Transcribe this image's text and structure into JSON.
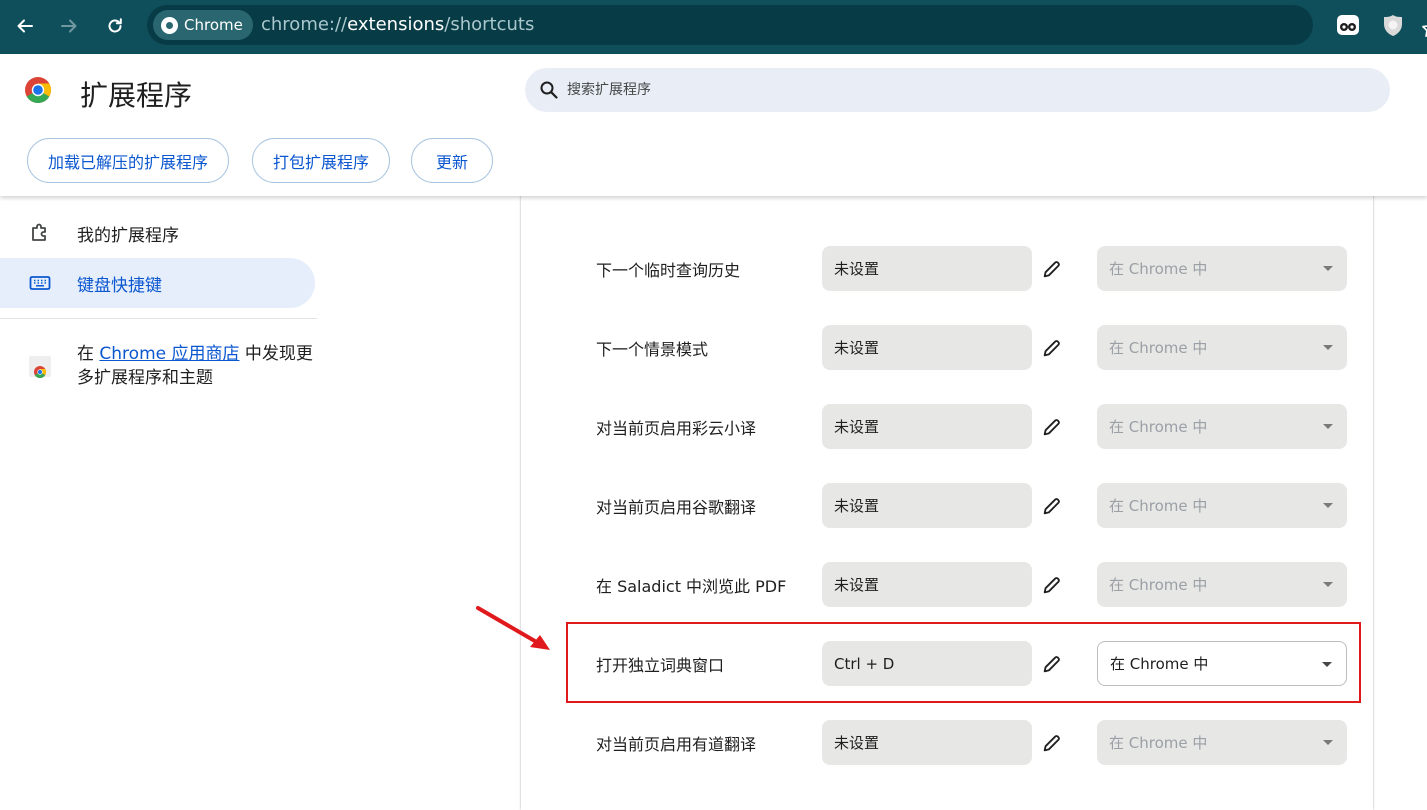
{
  "browser": {
    "chip_label": "Chrome",
    "url_prefix": "chrome://",
    "url_host": "extensions",
    "url_path": "/shortcuts",
    "icons": [
      "back-arrow-icon",
      "forward-arrow-icon",
      "reload-icon",
      "chrome-chip-icon",
      "bookmark-star-icon",
      "extension-face-icon",
      "extension-shield-icon"
    ]
  },
  "header": {
    "title": "扩展程序",
    "search_placeholder": "搜索扩展程序",
    "buttons": {
      "load_unpacked": "加载已解压的扩展程序",
      "pack": "打包扩展程序",
      "update": "更新"
    }
  },
  "sidebar": {
    "items": [
      {
        "label": "我的扩展程序",
        "icon": "puzzle-icon",
        "active": false
      },
      {
        "label": "键盘快捷键",
        "icon": "keyboard-icon",
        "active": true
      }
    ],
    "store": {
      "prefix": "在 ",
      "link": "Chrome 应用商店",
      "suffix": " 中发现更多扩展程序和主题",
      "icon": "webstore-icon"
    }
  },
  "shortcuts": {
    "rows": [
      {
        "command": "下一个临时查询历史",
        "key": "未设置",
        "scope": "在 Chrome 中",
        "enabled": false
      },
      {
        "command": "下一个情景模式",
        "key": "未设置",
        "scope": "在 Chrome 中",
        "enabled": false
      },
      {
        "command": "对当前页启用彩云小译",
        "key": "未设置",
        "scope": "在 Chrome 中",
        "enabled": false
      },
      {
        "command": "对当前页启用谷歌翻译",
        "key": "未设置",
        "scope": "在 Chrome 中",
        "enabled": false
      },
      {
        "command": "在 Saladict 中浏览此 PDF",
        "key": "未设置",
        "scope": "在 Chrome 中",
        "enabled": false
      },
      {
        "command": "打开独立词典窗口",
        "key": "Ctrl + D",
        "scope": "在 Chrome 中",
        "enabled": true
      },
      {
        "command": "对当前页启用有道翻译",
        "key": "未设置",
        "scope": "在 Chrome 中",
        "enabled": false
      }
    ]
  },
  "annotation": {
    "highlight_color": "#e0191d",
    "highlighted_command": "打开独立词典窗口"
  },
  "colors": {
    "toolbar_bg": "#0f4f5c",
    "accent": "#0b57d0",
    "sidebar_active_bg": "#e6eefb"
  }
}
